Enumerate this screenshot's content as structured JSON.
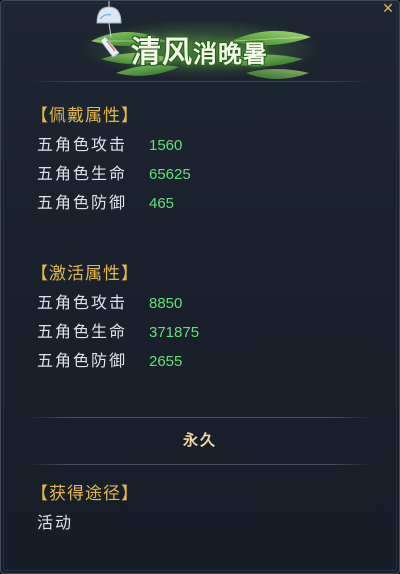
{
  "header": {
    "title_main": "清风",
    "title_small": "消晚暑",
    "icons": [
      "wind-chime-icon",
      "leaf-decoration-icon",
      "close-icon"
    ]
  },
  "sections": {
    "wear": {
      "title": "【佩戴属性】",
      "stats": [
        {
          "label": "五角色攻击",
          "value": "1560"
        },
        {
          "label": "五角色生命",
          "value": "65625"
        },
        {
          "label": "五角色防御",
          "value": "465"
        }
      ]
    },
    "activate": {
      "title": "【激活属性】",
      "stats": [
        {
          "label": "五角色攻击",
          "value": "8850"
        },
        {
          "label": "五角色生命",
          "value": "371875"
        },
        {
          "label": "五角色防御",
          "value": "2655"
        }
      ]
    },
    "duration": "永久",
    "source": {
      "title": "【获得途径】",
      "text": "活动"
    }
  },
  "colors": {
    "panel_bg": "#1a212c",
    "section_title": "#e1b84c",
    "stat_label": "#dfe3e8",
    "stat_value": "#5fe07a",
    "duration": "#f0d7a2"
  }
}
